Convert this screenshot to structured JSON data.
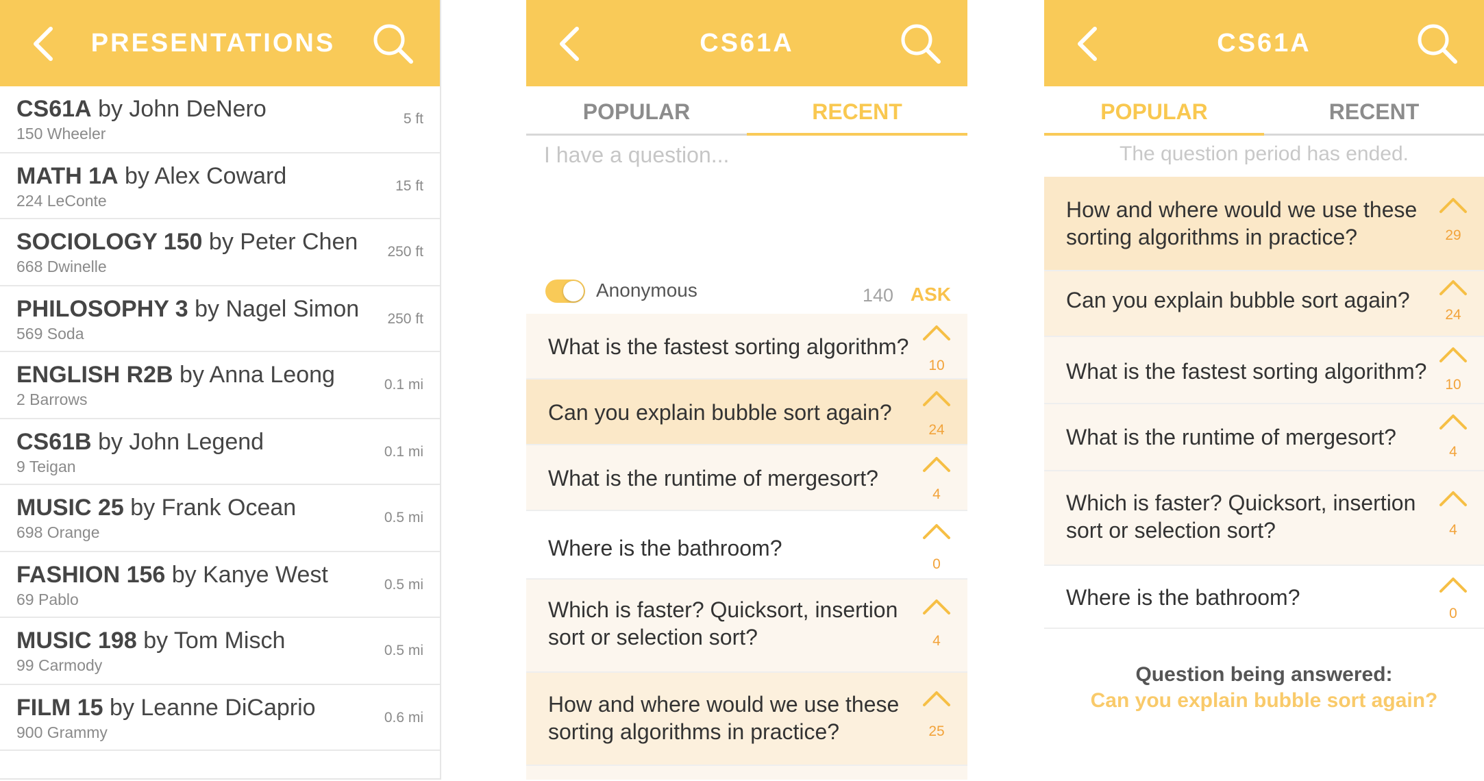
{
  "screen1": {
    "title": "PRESENTATIONS",
    "presentations": [
      {
        "course": "CS61A",
        "by": "by John DeNero",
        "location": "150 Wheeler",
        "distance": "5 ft"
      },
      {
        "course": "MATH 1A",
        "by": "by Alex Coward",
        "location": "224 LeConte",
        "distance": "15 ft"
      },
      {
        "course": "SOCIOLOGY 150",
        "by": "by Peter Chen",
        "location": "668 Dwinelle",
        "distance": "250 ft"
      },
      {
        "course": "PHILOSOPHY 3",
        "by": "by Nagel Simon",
        "location": "569 Soda",
        "distance": "250 ft"
      },
      {
        "course": "ENGLISH R2B",
        "by": "by Anna Leong",
        "location": "2 Barrows",
        "distance": "0.1 mi"
      },
      {
        "course": "CS61B",
        "by": "by John Legend",
        "location": "9 Teigan",
        "distance": "0.1 mi"
      },
      {
        "course": "MUSIC 25",
        "by": "by Frank Ocean",
        "location": "698 Orange",
        "distance": "0.5 mi"
      },
      {
        "course": "FASHION 156",
        "by": "by Kanye West",
        "location": "69 Pablo",
        "distance": "0.5 mi"
      },
      {
        "course": "MUSIC 198",
        "by": "by Tom Misch",
        "location": "99 Carmody",
        "distance": "0.5 mi"
      },
      {
        "course": "FILM 15",
        "by": "by Leanne DiCaprio",
        "location": "900 Grammy",
        "distance": "0.6 mi"
      }
    ]
  },
  "screen2": {
    "title": "CS61A",
    "tabs": {
      "popular": "POPULAR",
      "recent": "RECENT",
      "active": "recent"
    },
    "input_placeholder": "I have a question...",
    "anonymous_label": "Anonymous",
    "anonymous_on": true,
    "char_count": "140",
    "ask_label": "ASK",
    "questions": [
      {
        "text": "What is the fastest sorting algorithm?",
        "votes": "10"
      },
      {
        "text": "Can you explain bubble sort again?",
        "votes": "24"
      },
      {
        "text": "What is the runtime of mergesort?",
        "votes": "4"
      },
      {
        "text": "Where is the bathroom?",
        "votes": "0"
      },
      {
        "text": "Which is faster?  Quicksort, insertion",
        "text2": "sort or selection sort?",
        "votes": "4"
      },
      {
        "text": "How and where would we use these",
        "text2": "sorting algorithms in practice?",
        "votes": "25"
      }
    ]
  },
  "screen3": {
    "title": "CS61A",
    "tabs": {
      "popular": "POPULAR",
      "recent": "RECENT",
      "active": "popular"
    },
    "notice": "The question period has ended.",
    "questions": [
      {
        "text": "How and where would we use these",
        "text2": "sorting algorithms in practice?",
        "votes": "29"
      },
      {
        "text": "Can you explain bubble sort again?",
        "votes": "24"
      },
      {
        "text": "What is the fastest sorting algorithm?",
        "votes": "10"
      },
      {
        "text": "What is the runtime of mergesort?",
        "votes": "4"
      },
      {
        "text": "Which is faster?  Quicksort, insertion",
        "text2": "sort or selection sort?",
        "votes": "4"
      },
      {
        "text": "Where is the bathroom?",
        "votes": "0"
      }
    ],
    "answering_label": "Question being answered:",
    "answering_question": "Can you explain bubble sort again?"
  },
  "colors": {
    "accent": "#f9ca58",
    "accent_text": "#f9c850",
    "vote_count": "#f2a33a",
    "row_hot": "#fbe8c8",
    "row_warm": "#fcf0dd",
    "row_mild": "#fcf6ee"
  },
  "icons": {
    "back": "chevron-left-icon",
    "search": "magnifier-icon",
    "upvote": "chevron-up-icon"
  }
}
